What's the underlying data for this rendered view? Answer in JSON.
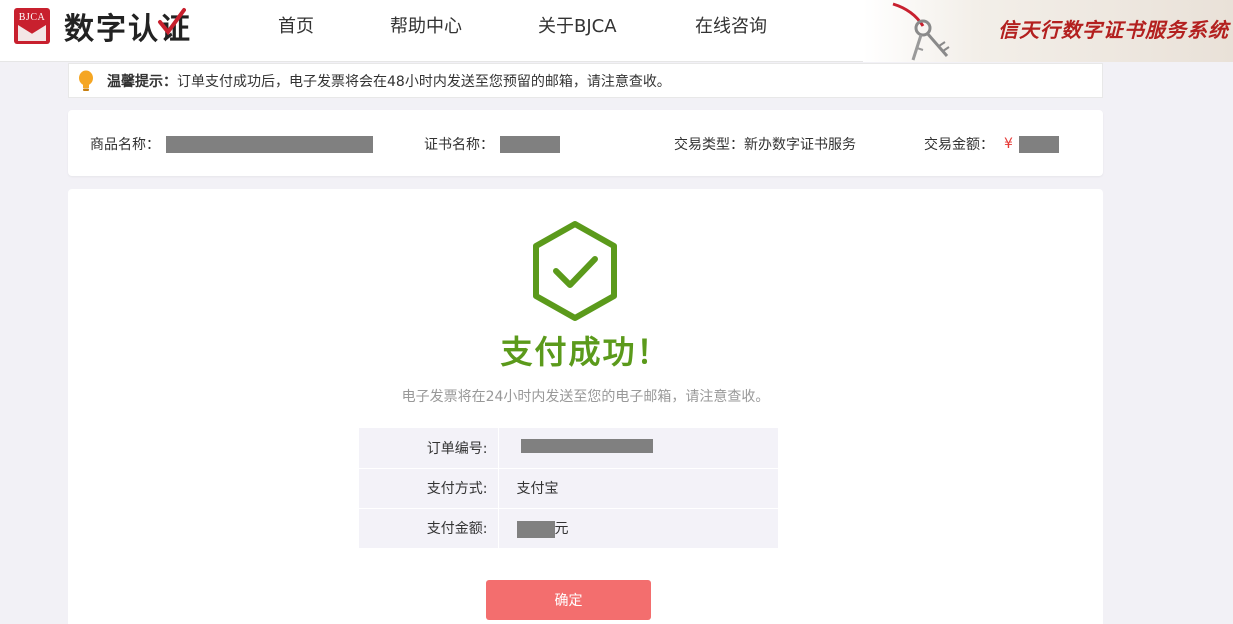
{
  "header": {
    "logo_abbr": "BJCA",
    "logo_text": "数字认证",
    "nav": [
      "首页",
      "帮助中心",
      "关于BJCA",
      "在线咨询"
    ],
    "banner_title": "信天行数字证书服务系统"
  },
  "tip": {
    "title": "温馨提示：",
    "text": "订单支付成功后，电子发票将会在48小时内发送至您预留的邮箱，请注意查收。"
  },
  "info": {
    "product_label": "商品名称：",
    "cert_label": "证书名称：",
    "trade_type_label": "交易类型：",
    "trade_type_value": "新办数字证书服务",
    "amount_label": "交易金额：",
    "currency": "¥"
  },
  "result": {
    "title": "支付成功！",
    "subtitle": "电子发票将在24小时内发送至您的电子邮箱，请注意查收。",
    "rows": [
      {
        "key": "订单编号:",
        "value": ""
      },
      {
        "key": "支付方式:",
        "value": "支付宝"
      },
      {
        "key": "支付金额:",
        "value": "元"
      }
    ],
    "confirm_label": "确定"
  },
  "colors": {
    "success_green": "#5b9a1b",
    "confirm_button": "#f36e6e",
    "brand_red": "#c8202e",
    "currency_red": "#e53935"
  }
}
